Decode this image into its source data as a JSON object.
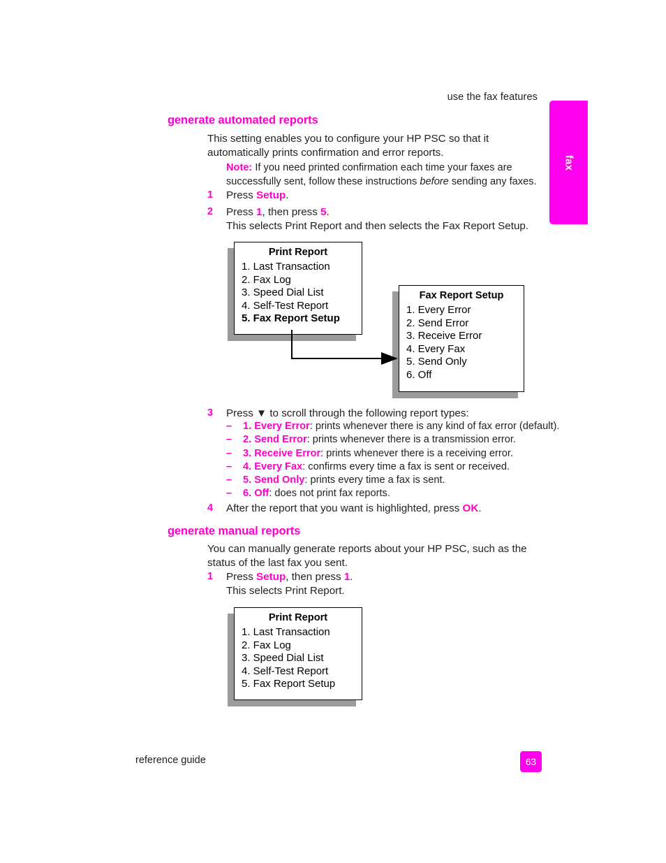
{
  "header": {
    "running_head": "use the fax features",
    "thumb_tab_label": "fax"
  },
  "sections": {
    "automated": {
      "heading": "generate automated reports",
      "intro": "This setting enables you to configure your HP PSC so that it automatically prints confirmation and error reports.",
      "note_label": "Note:",
      "note_part1": "If you need printed confirmation each time your faxes are successfully sent, follow these instructions ",
      "note_italic": "before",
      "note_part2": " sending any faxes.",
      "step1_num": "1",
      "step1_pre": "Press ",
      "step1_key": "Setup",
      "step1_post": ".",
      "step2_num": "2",
      "step2_pre": "Press ",
      "step2_key1": "1",
      "step2_mid": ", then press ",
      "step2_key2": "5",
      "step2_post": ".",
      "step2_sub": "This selects Print Report and then selects the Fax Report Setup.",
      "step3_num": "3",
      "step3_pre": "Press ",
      "step3_glyph": "▼",
      "step3_post": " to scroll through the following report types:",
      "step4_num": "4",
      "step4_pre": "After the report that you want is highlighted, press ",
      "step4_key": "OK",
      "step4_post": "."
    },
    "manual": {
      "heading": "generate manual reports",
      "intro": "You can manually generate reports about your HP PSC, such as the status of the last fax you sent.",
      "step1_num": "1",
      "step1_pre": "Press ",
      "step1_key1": "Setup",
      "step1_mid": ", then press ",
      "step1_key2": "1",
      "step1_post": ".",
      "step1_sub": "This selects Print Report."
    }
  },
  "report_types": [
    {
      "dash": "–",
      "option": "1. Every Error",
      "description": ": prints whenever there is any kind of fax error (default)."
    },
    {
      "dash": "–",
      "option": "2. Send Error",
      "description": ": prints whenever there is a transmission error."
    },
    {
      "dash": "–",
      "option": "3. Receive Error",
      "description": ": prints whenever there is a receiving error."
    },
    {
      "dash": "–",
      "option": "4. Every Fax",
      "description": ": confirms every time a fax is sent or received."
    },
    {
      "dash": "–",
      "option": "5. Send Only",
      "description": ": prints every time a fax is sent."
    },
    {
      "dash": "–",
      "option": "6. Off",
      "description": ": does not print fax reports."
    }
  ],
  "lcd_boxes": {
    "print_report_1": {
      "title": "Print Report",
      "items": [
        "1. Last Transaction",
        "2. Fax Log",
        "3. Speed Dial List",
        "4. Self-Test Report",
        "5. Fax Report Setup"
      ],
      "bold_item_index": 4
    },
    "fax_report_setup": {
      "title": "Fax Report Setup",
      "items": [
        "1. Every Error",
        "2. Send Error",
        "3. Receive Error",
        "4. Every Fax",
        "5. Send Only",
        "6. Off"
      ],
      "bold_item_index": -1
    },
    "print_report_2": {
      "title": "Print Report",
      "items": [
        "1. Last Transaction",
        "2. Fax Log",
        "3. Speed Dial List",
        "4. Self-Test Report",
        "5. Fax Report Setup"
      ],
      "bold_item_index": -1
    }
  },
  "footer": {
    "guide_label": "reference guide",
    "page_number": "63"
  },
  "colors": {
    "magenta": "#ff00cc",
    "tab_magenta": "#ff00ee",
    "shadow_gray": "#9b9b9b",
    "body_text": "#231f20"
  }
}
